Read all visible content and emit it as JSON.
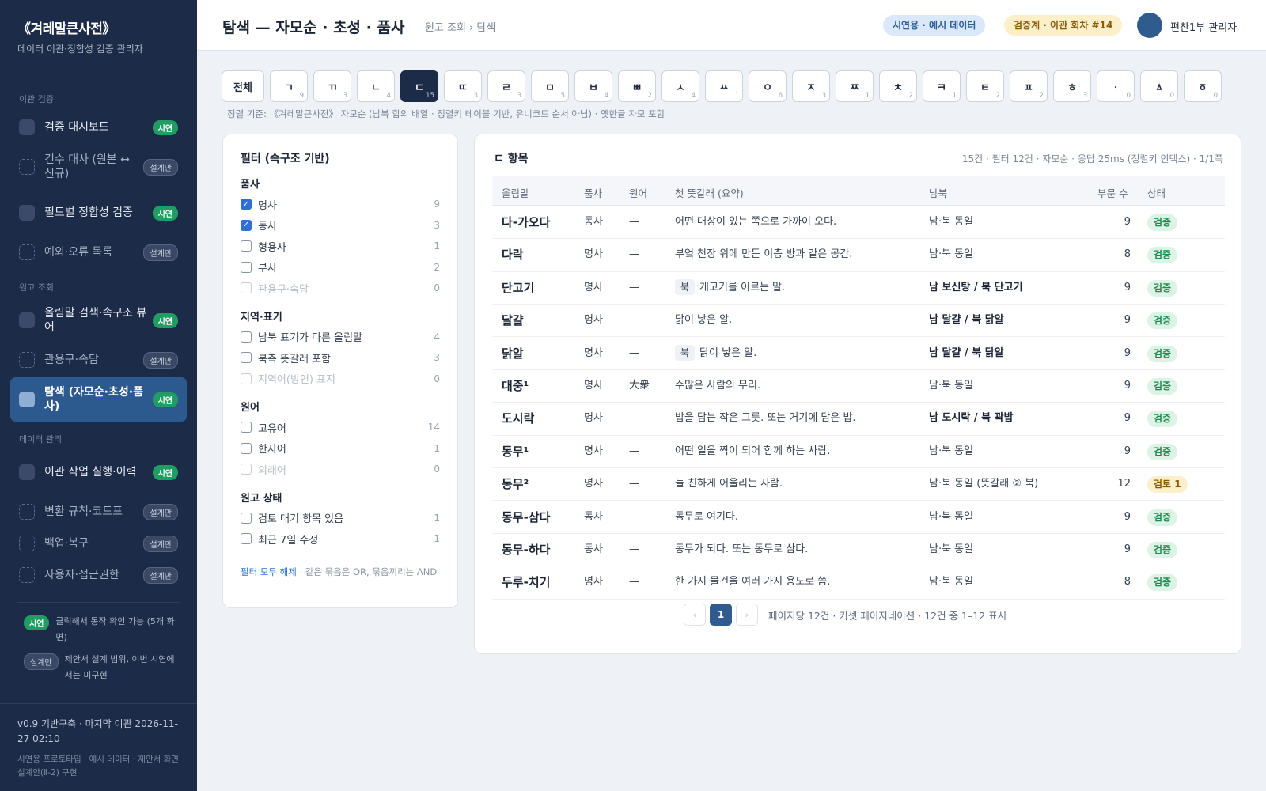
{
  "brand": {
    "title": "《겨레말큰사전》",
    "subtitle": "데이터 이관·정합성 검증 관리자"
  },
  "sidebar": {
    "sections": [
      "이관 검증",
      "원고 조회",
      "데이터 관리"
    ],
    "items": [
      {
        "label": "검증 대시보드",
        "badge": "시연"
      },
      {
        "label": "건수 대사 (원본 ↔ 신규)",
        "badge": "설계만"
      },
      {
        "label": "필드별 정합성 검증",
        "badge": "시연"
      },
      {
        "label": "예외·오류 목록",
        "badge": "설계만"
      },
      {
        "label": "올림말 검색·속구조 뷰어",
        "badge": "시연"
      },
      {
        "label": "관용구·속담",
        "badge": "설계만"
      },
      {
        "label": "탐색 (자모순·초성·품사)",
        "badge": "시연"
      },
      {
        "label": "이관 작업 실행·이력",
        "badge": "시연"
      },
      {
        "label": "변환 규칙·코드표",
        "badge": "설계만"
      },
      {
        "label": "백업·복구",
        "badge": "설계만"
      },
      {
        "label": "사용자·접근권한",
        "badge": "설계만"
      }
    ],
    "legend": [
      {
        "badge": "시연",
        "text": "클릭해서 동작 확인 가능 (5개 화면)"
      },
      {
        "badge": "설계만",
        "text": "제안서 설계 범위, 이번 시연에서는 미구현"
      }
    ],
    "footer": {
      "version": "v0.9 기반구축 · 마지막 이관 2026-11-27 02:10",
      "note": "시연용 프로토타입 · 예시 데이터 · 제안서 화면 설계안(Ⅱ-2) 구현"
    }
  },
  "header": {
    "title": "탐색 — 자모순 · 초성 · 품사",
    "breadcrumb": "원고 조회 › 탐색",
    "pill_demo": "시연용 · 예시 데이터",
    "pill_verify": "검증계 · 이관 회차 #14",
    "user": "편찬1부 관리자"
  },
  "letters": [
    {
      "label": "전체",
      "count": ""
    },
    {
      "label": "ㄱ",
      "count": "9"
    },
    {
      "label": "ㄲ",
      "count": "3"
    },
    {
      "label": "ㄴ",
      "count": "4"
    },
    {
      "label": "ㄷ",
      "count": "15"
    },
    {
      "label": "ㄸ",
      "count": "3"
    },
    {
      "label": "ㄹ",
      "count": "3"
    },
    {
      "label": "ㅁ",
      "count": "5"
    },
    {
      "label": "ㅂ",
      "count": "4"
    },
    {
      "label": "ㅃ",
      "count": "2"
    },
    {
      "label": "ㅅ",
      "count": "4"
    },
    {
      "label": "ㅆ",
      "count": "1"
    },
    {
      "label": "ㅇ",
      "count": "6"
    },
    {
      "label": "ㅈ",
      "count": "3"
    },
    {
      "label": "ㅉ",
      "count": "1"
    },
    {
      "label": "ㅊ",
      "count": "2"
    },
    {
      "label": "ㅋ",
      "count": "1"
    },
    {
      "label": "ㅌ",
      "count": "2"
    },
    {
      "label": "ㅍ",
      "count": "2"
    },
    {
      "label": "ㅎ",
      "count": "3"
    },
    {
      "label": "ㆍ",
      "count": "0"
    },
    {
      "label": "ㅿ",
      "count": "0"
    },
    {
      "label": "ㆆ",
      "count": "0"
    }
  ],
  "active_letter": "ㄷ",
  "sort_note": "정렬 기준: 《겨레말큰사전》 자모순 (남북 합의 배열 · 정렬키 테이블 기반, 유니코드 순서 아님) · 옛한글 자모 포함",
  "filter": {
    "title": "필터 (속구조 기반)",
    "groups": [
      {
        "title": "품사",
        "options": [
          {
            "label": "명사",
            "count": "9",
            "checked": true,
            "dim": false
          },
          {
            "label": "동사",
            "count": "3",
            "checked": true,
            "dim": false
          },
          {
            "label": "형용사",
            "count": "1",
            "checked": false,
            "dim": false
          },
          {
            "label": "부사",
            "count": "2",
            "checked": false,
            "dim": false
          },
          {
            "label": "관용구·속담",
            "count": "0",
            "checked": false,
            "dim": true
          }
        ]
      },
      {
        "title": "지역·표기",
        "options": [
          {
            "label": "남북 표기가 다른 올림말",
            "count": "4",
            "checked": false,
            "dim": false
          },
          {
            "label": "북측 뜻갈래 포함",
            "count": "3",
            "checked": false,
            "dim": false
          },
          {
            "label": "지역어(방언) 표지",
            "count": "0",
            "checked": false,
            "dim": true
          }
        ]
      },
      {
        "title": "원어",
        "options": [
          {
            "label": "고유어",
            "count": "14",
            "checked": false,
            "dim": false
          },
          {
            "label": "한자어",
            "count": "1",
            "checked": false,
            "dim": false
          },
          {
            "label": "외래어",
            "count": "0",
            "checked": false,
            "dim": true
          }
        ]
      },
      {
        "title": "원고 상태",
        "options": [
          {
            "label": "검토 대기 항목 있음",
            "count": "1",
            "checked": false,
            "dim": false
          },
          {
            "label": "최근 7일 수정",
            "count": "1",
            "checked": false,
            "dim": false
          }
        ]
      }
    ],
    "clear_link": "필터 모두 해제",
    "clear_note": " · 같은 묶음은 OR, 묶음끼리는 AND"
  },
  "results": {
    "title": "ㄷ 항목",
    "meta": "15건 · 필터 12건 · 자모순 · 응답 25ms (정렬키 인덱스) · 1/1쪽",
    "columns": [
      "올림말",
      "품사",
      "원어",
      "첫 뜻갈래 (요약)",
      "남북",
      "부문 수",
      "상태"
    ],
    "rows": [
      {
        "word": "다-가오다",
        "pos": "동사",
        "origin": "—",
        "tag": "",
        "def": "어떤 대상이 있는 쪽으로 가까이 오다.",
        "nb": "남·북 동일",
        "nb_bold": false,
        "count": "9",
        "status": "검증",
        "review": false
      },
      {
        "word": "다락",
        "pos": "명사",
        "origin": "—",
        "tag": "",
        "def": "부엌 천장 위에 만든 이층 방과 같은 공간.",
        "nb": "남·북 동일",
        "nb_bold": false,
        "count": "8",
        "status": "검증",
        "review": false
      },
      {
        "word": "단고기",
        "pos": "명사",
        "origin": "—",
        "tag": "북",
        "def": "개고기를 이르는 말.",
        "nb": "남 보신탕 / 북 단고기",
        "nb_bold": true,
        "count": "9",
        "status": "검증",
        "review": false
      },
      {
        "word": "달걀",
        "pos": "명사",
        "origin": "—",
        "tag": "",
        "def": "닭이 낳은 알.",
        "nb": "남 달걀 / 북 닭알",
        "nb_bold": true,
        "count": "9",
        "status": "검증",
        "review": false
      },
      {
        "word": "닭알",
        "pos": "명사",
        "origin": "—",
        "tag": "북",
        "def": "닭이 낳은 알.",
        "nb": "남 달걀 / 북 닭알",
        "nb_bold": true,
        "count": "9",
        "status": "검증",
        "review": false
      },
      {
        "word": "대중¹",
        "pos": "명사",
        "origin": "大衆",
        "tag": "",
        "def": "수많은 사람의 무리.",
        "nb": "남·북 동일",
        "nb_bold": false,
        "count": "9",
        "status": "검증",
        "review": false
      },
      {
        "word": "도시락",
        "pos": "명사",
        "origin": "—",
        "tag": "",
        "def": "밥을 담는 작은 그릇. 또는 거기에 담은 밥.",
        "nb": "남 도시락 / 북 곽밥",
        "nb_bold": true,
        "count": "9",
        "status": "검증",
        "review": false
      },
      {
        "word": "동무¹",
        "pos": "명사",
        "origin": "—",
        "tag": "",
        "def": "어떤 일을 짝이 되어 함께 하는 사람.",
        "nb": "남·북 동일",
        "nb_bold": false,
        "count": "9",
        "status": "검증",
        "review": false
      },
      {
        "word": "동무²",
        "pos": "명사",
        "origin": "—",
        "tag": "",
        "def": "늘 친하게 어울리는 사람.",
        "nb": "남·북 동일 (뜻갈래 ② 북)",
        "nb_bold": false,
        "count": "12",
        "status": "검토 1",
        "review": true
      },
      {
        "word": "동무-삼다",
        "pos": "동사",
        "origin": "—",
        "tag": "",
        "def": "동무로 여기다.",
        "nb": "남·북 동일",
        "nb_bold": false,
        "count": "9",
        "status": "검증",
        "review": false
      },
      {
        "word": "동무-하다",
        "pos": "동사",
        "origin": "—",
        "tag": "",
        "def": "동무가 되다. 또는 동무로 삼다.",
        "nb": "남·북 동일",
        "nb_bold": false,
        "count": "9",
        "status": "검증",
        "review": false
      },
      {
        "word": "두루-치기",
        "pos": "명사",
        "origin": "—",
        "tag": "",
        "def": "한 가지 물건을 여러 가지 용도로 씀.",
        "nb": "남·북 동일",
        "nb_bold": false,
        "count": "8",
        "status": "검증",
        "review": false
      }
    ],
    "pager": {
      "prev": "‹",
      "page": "1",
      "next": "›",
      "info": "페이지당 12건 · 키셋 페이지네이션 · 12건 중 1–12 표시"
    }
  }
}
